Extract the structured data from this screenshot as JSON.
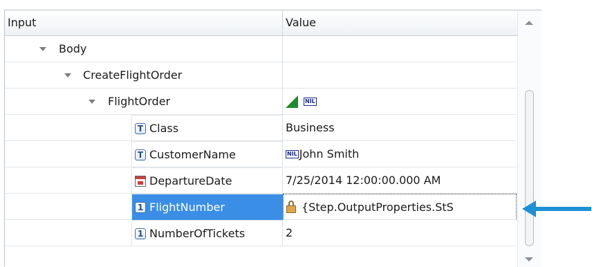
{
  "columns": {
    "input": "Input",
    "value": "Value"
  },
  "rows": [
    {
      "name": "Body",
      "value": ""
    },
    {
      "name": "CreateFlightOrder",
      "value": ""
    },
    {
      "name": "FlightOrder",
      "value_badge": "NIL"
    },
    {
      "name": "Class",
      "icon": "T",
      "value": "Business"
    },
    {
      "name": "CustomerName",
      "icon": "T",
      "value_badge": "NIL",
      "value": "John Smith"
    },
    {
      "name": "DepartureDate",
      "icon": "calendar-icon",
      "value": "7/25/2014 12:00:00.000 AM"
    },
    {
      "name": "FlightNumber",
      "icon": "1",
      "value": "{Step.OutputProperties.StS"
    },
    {
      "name": "NumberOfTickets",
      "icon": "1",
      "value": "2"
    }
  ],
  "colors": {
    "selection": "#3a8ee6",
    "arrow": "#1e90d6",
    "flag": "#1e8a2a"
  }
}
